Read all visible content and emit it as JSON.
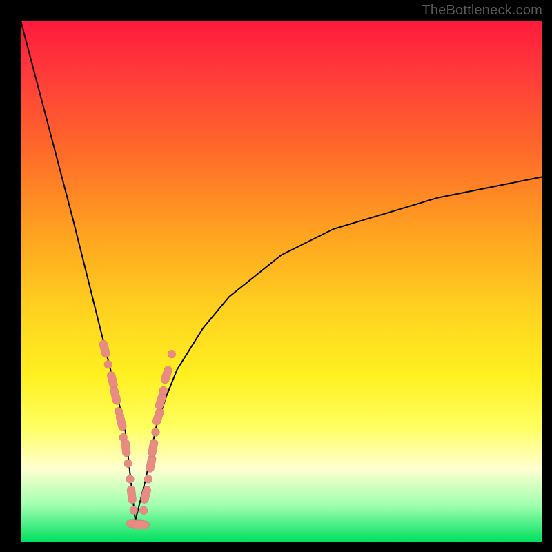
{
  "watermark": "TheBottleneck.com",
  "colors": {
    "frame": "#000000",
    "gradient_top": "#ff1a3c",
    "gradient_bottom": "#00e060",
    "curve": "#000000",
    "bead": "#e98a83"
  },
  "chart_data": {
    "type": "line",
    "title": "",
    "xlabel": "",
    "ylabel": "",
    "xlim": [
      0,
      100
    ],
    "ylim": [
      0,
      100
    ],
    "note": "V-shaped bottleneck curve; y≈100 at x≈0, reaches y≈0 near x≈22, rises toward ~70 at x=100. Axis values are estimated from geometry (no tick labels present).",
    "x": [
      0,
      5,
      10,
      13,
      16,
      18,
      20,
      22,
      24,
      26,
      28,
      30,
      35,
      40,
      50,
      60,
      70,
      80,
      90,
      100
    ],
    "values": [
      100,
      81,
      62,
      50,
      38,
      30,
      22,
      4,
      12,
      22,
      28,
      33,
      41,
      47,
      55,
      60,
      63,
      66,
      68,
      70
    ],
    "markers": {
      "note": "Salmon bead markers clustered along both arms near the valley; pill = elongated, round = small circle.",
      "left_arm": [
        {
          "x": 16.1,
          "y": 37,
          "shape": "pill"
        },
        {
          "x": 16.8,
          "y": 34,
          "shape": "round"
        },
        {
          "x": 17.6,
          "y": 31,
          "shape": "pill"
        },
        {
          "x": 18.2,
          "y": 28,
          "shape": "pill"
        },
        {
          "x": 18.8,
          "y": 25,
          "shape": "round"
        },
        {
          "x": 19.3,
          "y": 23,
          "shape": "pill"
        },
        {
          "x": 19.7,
          "y": 20,
          "shape": "round"
        },
        {
          "x": 20.2,
          "y": 18,
          "shape": "pill"
        },
        {
          "x": 20.6,
          "y": 15,
          "shape": "round"
        },
        {
          "x": 21.0,
          "y": 12,
          "shape": "round"
        },
        {
          "x": 21.3,
          "y": 9,
          "shape": "pill"
        },
        {
          "x": 21.7,
          "y": 6,
          "shape": "round"
        }
      ],
      "bottom": [
        {
          "x": 22.0,
          "y": 3.5,
          "shape": "pill"
        },
        {
          "x": 23.0,
          "y": 3.2,
          "shape": "pill"
        }
      ],
      "right_arm": [
        {
          "x": 23.6,
          "y": 6,
          "shape": "round"
        },
        {
          "x": 24.0,
          "y": 9,
          "shape": "pill"
        },
        {
          "x": 24.5,
          "y": 12,
          "shape": "round"
        },
        {
          "x": 25.0,
          "y": 15,
          "shape": "pill"
        },
        {
          "x": 25.4,
          "y": 18,
          "shape": "pill"
        },
        {
          "x": 25.9,
          "y": 21,
          "shape": "round"
        },
        {
          "x": 26.4,
          "y": 24,
          "shape": "pill"
        },
        {
          "x": 26.9,
          "y": 27,
          "shape": "pill"
        },
        {
          "x": 27.4,
          "y": 29,
          "shape": "round"
        },
        {
          "x": 28.0,
          "y": 32,
          "shape": "pill"
        },
        {
          "x": 29.0,
          "y": 36,
          "shape": "round"
        }
      ]
    }
  }
}
